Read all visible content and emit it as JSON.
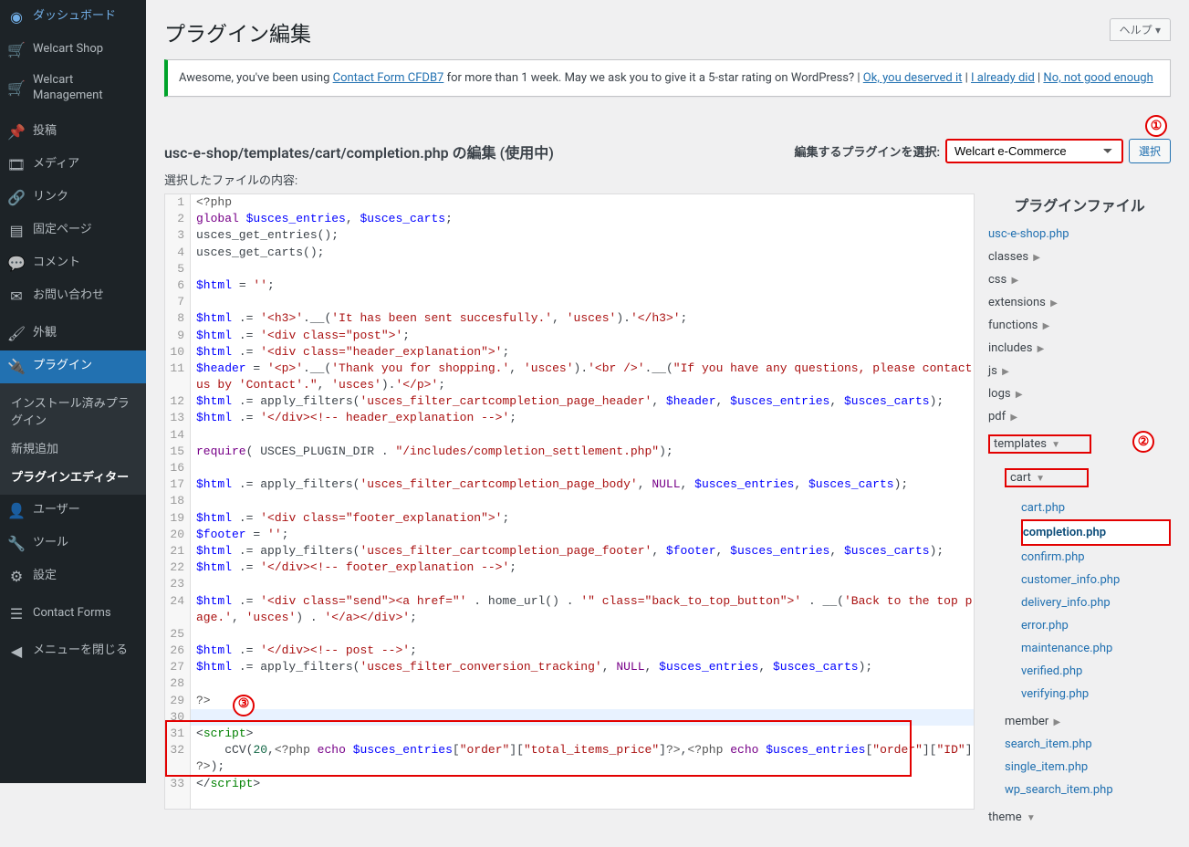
{
  "sidebar": {
    "items": [
      {
        "icon": "dash",
        "label": "ダッシュボード"
      },
      {
        "icon": "cart",
        "label": "Welcart Shop"
      },
      {
        "icon": "cart",
        "label": "Welcart Management"
      }
    ],
    "items2": [
      {
        "icon": "pin",
        "label": "投稿"
      },
      {
        "icon": "media",
        "label": "メディア"
      },
      {
        "icon": "link",
        "label": "リンク"
      },
      {
        "icon": "page",
        "label": "固定ページ"
      },
      {
        "icon": "comment",
        "label": "コメント"
      },
      {
        "icon": "mail",
        "label": "お問い合わせ"
      }
    ],
    "items3": [
      {
        "icon": "brush",
        "label": "外観"
      },
      {
        "icon": "plug",
        "label": "プラグイン",
        "active": true
      }
    ],
    "submenu": [
      {
        "label": "インストール済みプラグイン"
      },
      {
        "label": "新規追加"
      },
      {
        "label": "プラグインエディター",
        "current": true
      }
    ],
    "items4": [
      {
        "icon": "user",
        "label": "ユーザー"
      },
      {
        "icon": "tool",
        "label": "ツール"
      },
      {
        "icon": "settings",
        "label": "設定"
      }
    ],
    "items5": [
      {
        "icon": "form",
        "label": "Contact Forms"
      }
    ],
    "collapse": "メニューを閉じる"
  },
  "header": {
    "title": "プラグイン編集",
    "help": "ヘルプ ▾"
  },
  "notice": {
    "text1": "Awesome, you've been using ",
    "link1": "Contact Form CFDB7",
    "text2": " for more than 1 week. May we ask you to give it a 5-star rating on WordPress? | ",
    "link2": "Ok, you deserved it",
    "sep1": " | ",
    "link3": "I already did",
    "sep2": " | ",
    "link4": "No, not good enough"
  },
  "subheader": "usc-e-shop/templates/cart/completion.php の編集 (使用中)",
  "plugin_select_label": "編集するプラグインを選択:",
  "plugin_select_value": "Welcart e-Commerce",
  "select_button": "選択",
  "content_label": "選択したファイルの内容:",
  "files_heading": "プラグインファイル",
  "callouts": {
    "one": "①",
    "two": "②",
    "three": "③"
  },
  "code": {
    "l1": "<?php",
    "l2_b": "global ",
    "l2_v1": "$usces_entries",
    "l2_m": ", ",
    "l2_v2": "$usces_carts",
    "l2_e": ";",
    "l3": "usces_get_entries();",
    "l4": "usces_get_carts();",
    "l6_v": "$html",
    "l6_e": " = ",
    "l6_s": "''",
    "l6_t": ";",
    "l8_v": "$html",
    "l8_a": " .= ",
    "l8_s1": "'<h3>'",
    "l8_m": ".__(",
    "l8_s2": "'It has been sent succesfully.'",
    "l8_c": ", ",
    "l8_s3": "'usces'",
    "l8_m2": ").",
    "l8_s4": "'</h3>'",
    "l8_t": ";",
    "l9_v": "$html",
    "l9_a": " .= ",
    "l9_s": "'<div class=\"post\">'",
    "l9_t": ";",
    "l10_v": "$html",
    "l10_a": " .= ",
    "l10_s": "'<div class=\"header_explanation\">'",
    "l10_t": ";",
    "l11_v": "$header",
    "l11_a": " = ",
    "l11_s1": "'<p>'",
    "l11_m1": ".__(",
    "l11_s2": "'Thank you for shopping.'",
    "l11_c1": ", ",
    "l11_s3": "'usces'",
    "l11_m2": ").",
    "l11_s4": "'<br />'",
    "l11_m3": ".__(",
    "l11_s5": "\"If you have any questions, please contact us by 'Contact'.\"",
    "l11_c2": ", ",
    "l11_s6": "'usces'",
    "l11_m4": ").",
    "l11_s7": "'</p>'",
    "l11_t": ";",
    "l12_v": "$html",
    "l12_a": " .= apply_filters(",
    "l12_s1": "'usces_filter_cartcompletion_page_header'",
    "l12_c": ", ",
    "l12_v1": "$header",
    "l12_v2": "$usces_entries",
    "l12_v3": "$usces_carts",
    "l12_t": ");",
    "l13_v": "$html",
    "l13_a": " .= ",
    "l13_s": "'</div><!-- header_explanation -->'",
    "l13_t": ";",
    "l15_k": "require",
    "l15_p": "( USCES_PLUGIN_DIR . ",
    "l15_s": "\"/includes/completion_settlement.php\"",
    "l15_t": ");",
    "l17_v": "$html",
    "l17_a": " .= apply_filters(",
    "l17_s1": "'usces_filter_cartcompletion_page_body'",
    "l17_c": ", ",
    "l17_k": "NULL",
    "l17_v2": "$usces_entries",
    "l17_v3": "$usces_carts",
    "l17_t": ");",
    "l19_v": "$html",
    "l19_a": " .= ",
    "l19_s": "'<div class=\"footer_explanation\">'",
    "l19_t": ";",
    "l20_v": "$footer",
    "l20_a": " = ",
    "l20_s": "''",
    "l20_t": ";",
    "l21_v": "$html",
    "l21_a": " .= apply_filters(",
    "l21_s1": "'usces_filter_cartcompletion_page_footer'",
    "l21_c": ", ",
    "l21_v1": "$footer",
    "l21_v2": "$usces_entries",
    "l21_v3": "$usces_carts",
    "l21_t": ");",
    "l22_v": "$html",
    "l22_a": " .= ",
    "l22_s": "'</div><!-- footer_explanation -->'",
    "l22_t": ";",
    "l24_v": "$html",
    "l24_a": " .= ",
    "l24_s1": "'<div class=\"send\"><a href=\"'",
    "l24_m1": " . home_url() . ",
    "l24_s2": "'\" class=\"back_to_top_button\">'",
    "l24_m2": " . __(",
    "l24_s3": "'Back to the top page.'",
    "l24_c": ", ",
    "l24_s4": "'usces'",
    "l24_m3": ") . ",
    "l24_s5": "'</a></div>'",
    "l24_t": ";",
    "l26_v": "$html",
    "l26_a": " .= ",
    "l26_s": "'</div><!-- post -->'",
    "l26_t": ";",
    "l27_v": "$html",
    "l27_a": " .= apply_filters(",
    "l27_s1": "'usces_filter_conversion_tracking'",
    "l27_c": ", ",
    "l27_k": "NULL",
    "l27_v2": "$usces_entries",
    "l27_v3": "$usces_carts",
    "l27_t": ");",
    "l29": "?>",
    "l31_t1": "<",
    "l31_t2": "script",
    "l31_t3": ">",
    "l32_a": "    cCV(",
    "l32_n": "20",
    "l32_b": ",",
    "l32_p1": "<?php ",
    "l32_k1": "echo ",
    "l32_v1": "$usces_entries",
    "l32_b1": "[",
    "l32_s1": "\"order\"",
    "l32_b2": "][",
    "l32_s2": "\"total_items_price\"",
    "l32_b3": "]",
    "l32_p2": "?>",
    "l32_c": ",",
    "l32_p3": "<?php ",
    "l32_k2": "echo ",
    "l32_v2": "$usces_entries",
    "l32_b4": "[",
    "l32_s3": "\"order\"",
    "l32_b5": "][",
    "l32_s4": "\"ID\"",
    "l32_b6": "] ",
    "l32_p4": "?>",
    "l32_e": ");",
    "l33_t1": "</",
    "l33_t2": "script",
    "l33_t3": ">"
  },
  "files": {
    "root": "usc-e-shop.php",
    "folders1": [
      "classes",
      "css",
      "extensions",
      "functions",
      "includes",
      "js",
      "logs",
      "pdf"
    ],
    "templates": "templates",
    "cart": "cart",
    "cart_files": [
      "cart.php"
    ],
    "cart_current": "completion.php",
    "cart_files2": [
      "confirm.php",
      "customer_info.php",
      "delivery_info.php",
      "error.php",
      "maintenance.php",
      "verified.php",
      "verifying.php"
    ],
    "member": "member",
    "root_files": [
      "search_item.php",
      "single_item.php",
      "wp_search_item.php"
    ],
    "theme": "theme"
  }
}
